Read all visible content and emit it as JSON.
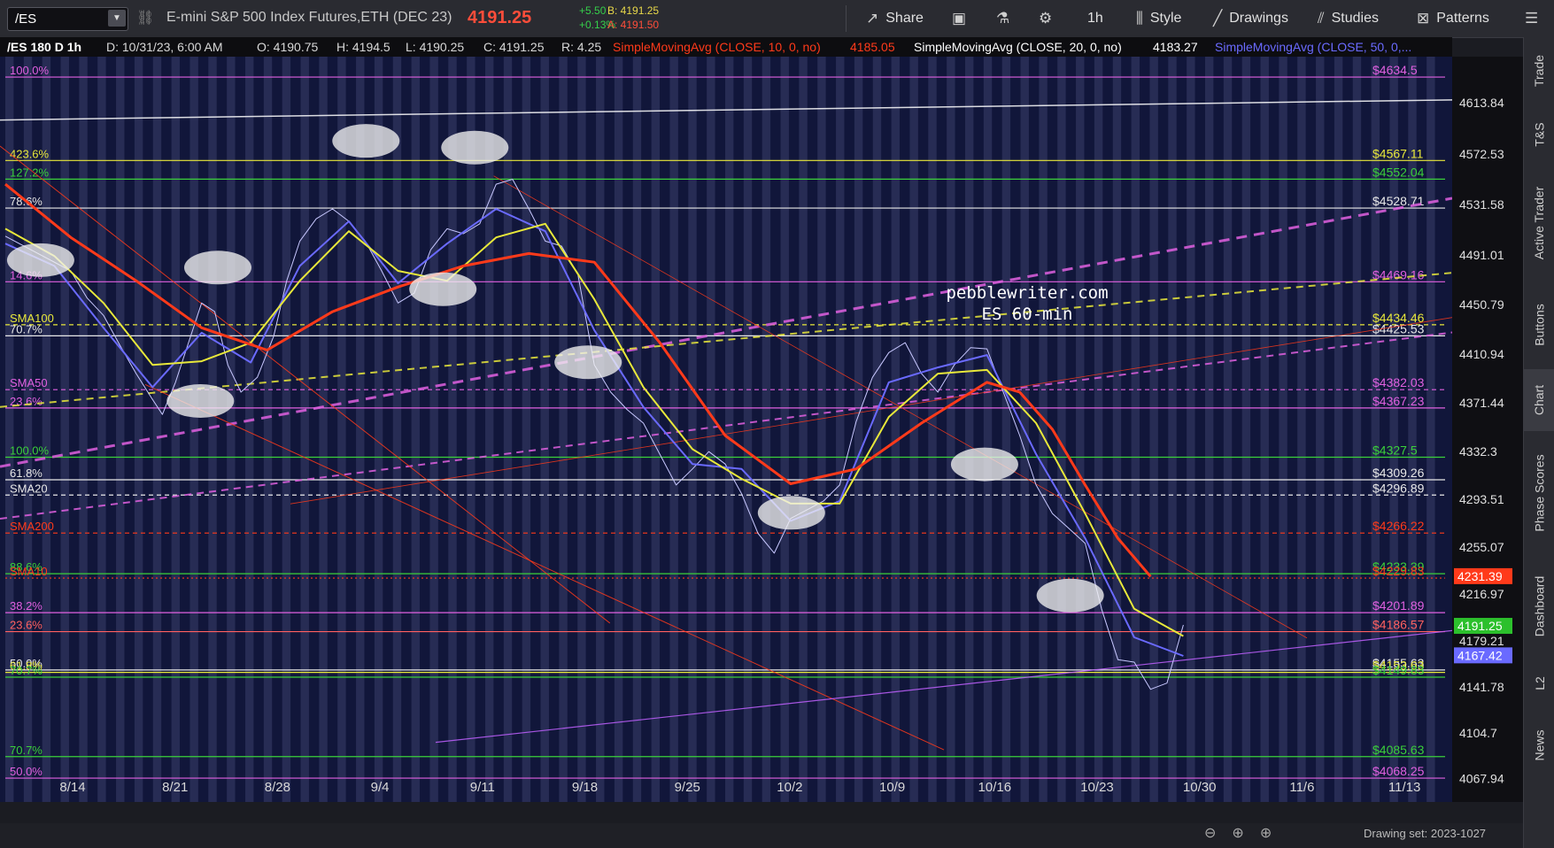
{
  "toolbar": {
    "symbol": "/ES",
    "description": "E-mini S&P 500 Index Futures,ETH (DEC 23)",
    "last_price": "4191.25",
    "change": "+5.50",
    "change_pct": "+0.13%",
    "bid": "B: 4191.25",
    "ask": "A: 4191.50",
    "share_label": "Share",
    "timeframe_label": "1h",
    "style_label": "Style",
    "drawings_label": "Drawings",
    "studies_label": "Studies",
    "patterns_label": "Patterns",
    "share_icon": "share-icon",
    "snapshot_icon": "camera-icon",
    "flask_icon": "flask-icon",
    "settings_icon": "gear-icon",
    "menu_icon": "menu-icon"
  },
  "infobar": {
    "chart_id": "/ES 180 D 1h",
    "date": "D: 10/31/23, 6:00 AM",
    "open": "O: 4190.75",
    "high": "H: 4194.5",
    "low": "L: 4190.25",
    "close": "C: 4191.25",
    "range": "R: 4.25",
    "sma10": "SimpleMovingAvg (CLOSE, 10, 0, no)",
    "sma10_val": "4185.05",
    "sma20": "SimpleMovingAvg (CLOSE, 20, 0, no)",
    "sma20_val": "4183.27",
    "sma50": "SimpleMovingAvg (CLOSE, 50, 0,..."
  },
  "right_tabs": [
    "Trade",
    "T&S",
    "Active Trader",
    "Buttons",
    "Chart",
    "Phase Scores",
    "Dashboard",
    "L2",
    "News"
  ],
  "right_tabs_active": "Chart",
  "watermark": {
    "line1": "pebblewriter.com",
    "line2": "ES 60-min"
  },
  "drawing_set": "Drawing set: 2023-1027",
  "colors": {
    "bg": "#11163a",
    "magenta": "#e060e0",
    "yellow": "#e8e83a",
    "green": "#3ad03a",
    "red": "#ff3a1a",
    "blue": "#6a6aff",
    "white": "#e8e8e8"
  },
  "chart_data": {
    "type": "line",
    "title": "",
    "xlabel": "",
    "ylabel": "",
    "ylim": [
      4049,
      4651
    ],
    "x_ticks": [
      "8/14",
      "8/21",
      "8/28",
      "9/4",
      "9/11",
      "9/18",
      "9/25",
      "10/2",
      "10/9",
      "10/16",
      "10/23",
      "10/30",
      "11/6",
      "11/13"
    ],
    "y_ticks": [
      "4613.84",
      "4572.53",
      "4531.58",
      "4491.01",
      "4450.79",
      "4410.94",
      "4371.44",
      "4332.3",
      "4293.51",
      "4255.07",
      "4216.97",
      "4179.21",
      "4141.78",
      "4104.7",
      "4067.94"
    ],
    "price_tags": [
      {
        "value": "4231.39",
        "color": "#ff3a1a"
      },
      {
        "value": "4191.25",
        "color": "#2cc02c"
      },
      {
        "value": "4167.42",
        "color": "#6a6aff"
      }
    ],
    "levels": [
      {
        "price": 4634.5,
        "label": "$4634.5",
        "left": "100.0%",
        "color": "#e060e0",
        "style": "solid"
      },
      {
        "price": 4567.11,
        "label": "$4567.11",
        "left": "423.6%",
        "color": "#e8e83a",
        "style": "solid"
      },
      {
        "price": 4552.04,
        "label": "$4552.04",
        "left": "127.2%",
        "color": "#3ad03a",
        "style": "solid"
      },
      {
        "price": 4528.71,
        "label": "$4528.71",
        "left": "78.6%",
        "color": "#e8e8e8",
        "style": "solid"
      },
      {
        "price": 4469.16,
        "label": "$4469.16",
        "left": "14.6%",
        "color": "#e060e0",
        "style": "solid"
      },
      {
        "price": 4434.46,
        "label": "$4434.46",
        "left": "SMA100",
        "color": "#e8e83a",
        "style": "dashed"
      },
      {
        "price": 4425.53,
        "label": "$4425.53",
        "left": "70.7%",
        "color": "#e8e8e8",
        "style": "solid"
      },
      {
        "price": 4382.03,
        "label": "$4382.03",
        "left": "SMA50",
        "color": "#e060e0",
        "style": "dashed"
      },
      {
        "price": 4367.23,
        "label": "$4367.23",
        "left": "23.6%",
        "color": "#e060e0",
        "style": "solid"
      },
      {
        "price": 4327.5,
        "label": "$4327.5",
        "left": "100.0%",
        "color": "#3ad03a",
        "style": "solid"
      },
      {
        "price": 4309.26,
        "label": "$4309.26",
        "left": "61.8%",
        "color": "#e8e8e8",
        "style": "solid"
      },
      {
        "price": 4296.89,
        "label": "$4296.89",
        "left": "SMA20",
        "color": "#e8e8e8",
        "style": "dashed"
      },
      {
        "price": 4266.22,
        "label": "$4266.22",
        "left": "SMA200",
        "color": "#ff3a1a",
        "style": "dashed"
      },
      {
        "price": 4233.39,
        "label": "$4233.39",
        "left": "88.6%",
        "color": "#3ad03a",
        "style": "solid"
      },
      {
        "price": 4229.83,
        "label": "$4229.83",
        "left": "SMA10",
        "color": "#ff3a1a",
        "style": "dotted"
      },
      {
        "price": 4201.89,
        "label": "$4201.89",
        "left": "38.2%",
        "color": "#e060e0",
        "style": "solid"
      },
      {
        "price": 4186.57,
        "label": "$4186.57",
        "left": "23.6%",
        "color": "#ff6060",
        "style": "solid"
      },
      {
        "price": 4155.63,
        "label": "$4155.63",
        "left": "50.0%",
        "color": "#e8e8e8",
        "style": "solid"
      },
      {
        "price": 4153.63,
        "label": "$4153.63",
        "left": "61.8%",
        "color": "#e8e83a",
        "style": "solid"
      },
      {
        "price": 4149.83,
        "label": "$4149.83",
        "left": "70.7%",
        "color": "#3ad03a",
        "style": "solid"
      },
      {
        "price": 4085.63,
        "label": "$4085.63",
        "left": "70.7%",
        "color": "#3ad03a",
        "style": "solid"
      },
      {
        "price": 4068.25,
        "label": "$4068.25",
        "left": "50.0%",
        "color": "#e060e0",
        "style": "solid"
      }
    ],
    "series": [
      {
        "name": "",
        "color": "#c8c8ff",
        "width": 1,
        "points": [
          [
            0,
            4506
          ],
          [
            2,
            4492
          ],
          [
            4,
            4478
          ],
          [
            5,
            4456
          ],
          [
            6,
            4442
          ],
          [
            7,
            4418
          ],
          [
            8,
            4395
          ],
          [
            9,
            4374
          ],
          [
            9.6,
            4362
          ],
          [
            10.4,
            4388
          ],
          [
            11.2,
            4420
          ],
          [
            12,
            4452
          ],
          [
            12.8,
            4445
          ],
          [
            13.6,
            4402
          ],
          [
            14.4,
            4380
          ],
          [
            15.4,
            4392
          ],
          [
            16.4,
            4425
          ],
          [
            17.2,
            4470
          ],
          [
            18,
            4502
          ],
          [
            19,
            4520
          ],
          [
            20,
            4528
          ],
          [
            21,
            4518
          ],
          [
            22,
            4502
          ],
          [
            23,
            4478
          ],
          [
            24,
            4452
          ],
          [
            25,
            4460
          ],
          [
            26,
            4495
          ],
          [
            27,
            4512
          ],
          [
            28,
            4508
          ],
          [
            29,
            4516
          ],
          [
            30,
            4548
          ],
          [
            31,
            4552
          ],
          [
            32,
            4528
          ],
          [
            33,
            4502
          ],
          [
            34,
            4498
          ],
          [
            35,
            4475
          ],
          [
            36,
            4402
          ],
          [
            37,
            4380
          ],
          [
            38,
            4366
          ],
          [
            39,
            4355
          ],
          [
            40,
            4330
          ],
          [
            41,
            4305
          ],
          [
            42,
            4318
          ],
          [
            43,
            4332
          ],
          [
            44,
            4322
          ],
          [
            45,
            4298
          ],
          [
            46,
            4266
          ],
          [
            47,
            4250
          ],
          [
            48,
            4278
          ],
          [
            49,
            4285
          ],
          [
            50,
            4292
          ],
          [
            51,
            4305
          ],
          [
            52,
            4356
          ],
          [
            53,
            4392
          ],
          [
            54,
            4412
          ],
          [
            55,
            4420
          ],
          [
            56,
            4395
          ],
          [
            57,
            4380
          ],
          [
            58,
            4402
          ],
          [
            59,
            4416
          ],
          [
            60,
            4415
          ],
          [
            61,
            4380
          ],
          [
            62,
            4345
          ],
          [
            63,
            4305
          ],
          [
            64,
            4282
          ],
          [
            65,
            4270
          ],
          [
            66,
            4258
          ],
          [
            67,
            4205
          ],
          [
            68,
            4164
          ],
          [
            69,
            4162
          ],
          [
            70,
            4140
          ],
          [
            71,
            4145
          ],
          [
            72,
            4192
          ]
        ]
      },
      {
        "name": "",
        "color": "#6a6aff",
        "width": 2,
        "points": [
          [
            0,
            4500
          ],
          [
            3,
            4482
          ],
          [
            6,
            4432
          ],
          [
            9,
            4384
          ],
          [
            12,
            4428
          ],
          [
            15,
            4404
          ],
          [
            18,
            4482
          ],
          [
            21,
            4518
          ],
          [
            24,
            4468
          ],
          [
            27,
            4500
          ],
          [
            30,
            4528
          ],
          [
            33,
            4510
          ],
          [
            36,
            4430
          ],
          [
            39,
            4368
          ],
          [
            42,
            4322
          ],
          [
            45,
            4318
          ],
          [
            48,
            4276
          ],
          [
            51,
            4292
          ],
          [
            54,
            4388
          ],
          [
            57,
            4400
          ],
          [
            60,
            4410
          ],
          [
            63,
            4330
          ],
          [
            66,
            4262
          ],
          [
            69,
            4182
          ],
          [
            72,
            4167
          ]
        ]
      },
      {
        "name": "",
        "color": "#e8e83a",
        "width": 2,
        "points": [
          [
            0,
            4512
          ],
          [
            3,
            4490
          ],
          [
            6,
            4452
          ],
          [
            9,
            4402
          ],
          [
            12,
            4405
          ],
          [
            15,
            4420
          ],
          [
            18,
            4470
          ],
          [
            21,
            4510
          ],
          [
            24,
            4478
          ],
          [
            27,
            4470
          ],
          [
            30,
            4505
          ],
          [
            33,
            4516
          ],
          [
            36,
            4455
          ],
          [
            39,
            4384
          ],
          [
            42,
            4334
          ],
          [
            45,
            4310
          ],
          [
            48,
            4290
          ],
          [
            51,
            4290
          ],
          [
            54,
            4360
          ],
          [
            57,
            4395
          ],
          [
            60,
            4398
          ],
          [
            63,
            4355
          ],
          [
            66,
            4282
          ],
          [
            69,
            4205
          ],
          [
            72,
            4183
          ]
        ]
      },
      {
        "name": "",
        "color": "#ff3a1a",
        "width": 3,
        "points": [
          [
            0,
            4548
          ],
          [
            4,
            4505
          ],
          [
            8,
            4470
          ],
          [
            12,
            4432
          ],
          [
            16,
            4414
          ],
          [
            20,
            4445
          ],
          [
            24,
            4465
          ],
          [
            28,
            4482
          ],
          [
            32,
            4492
          ],
          [
            36,
            4485
          ],
          [
            40,
            4420
          ],
          [
            44,
            4345
          ],
          [
            48,
            4306
          ],
          [
            52,
            4318
          ],
          [
            56,
            4355
          ],
          [
            60,
            4388
          ],
          [
            62,
            4380
          ],
          [
            64,
            4350
          ],
          [
            66,
            4305
          ],
          [
            68,
            4262
          ],
          [
            70,
            4231
          ]
        ]
      }
    ],
    "x_index_range": [
      0,
      88
    ]
  }
}
